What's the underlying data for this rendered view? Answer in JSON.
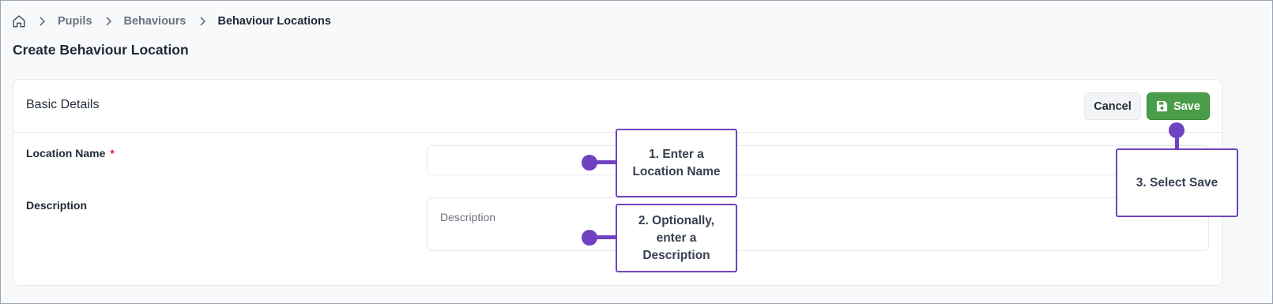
{
  "breadcrumb": {
    "items": [
      "Pupils",
      "Behaviours",
      "Behaviour Locations"
    ]
  },
  "page": {
    "title": "Create Behaviour Location"
  },
  "card": {
    "title": "Basic Details",
    "cancel_label": "Cancel",
    "save_label": "Save"
  },
  "form": {
    "location_name": {
      "label": "Location Name",
      "required_mark": "*",
      "value": ""
    },
    "description": {
      "label": "Description",
      "placeholder": "Description",
      "value": ""
    }
  },
  "callouts": {
    "step1": "1. Enter a Location Name",
    "step2": "2. Optionally, enter a Description",
    "step3": "3. Select Save"
  },
  "colors": {
    "accent": "#6f42c1",
    "save_button": "#4a9d48",
    "required": "#dc2626"
  },
  "icons": [
    "home-icon",
    "chevron-right-icon",
    "floppy-disk-icon"
  ]
}
